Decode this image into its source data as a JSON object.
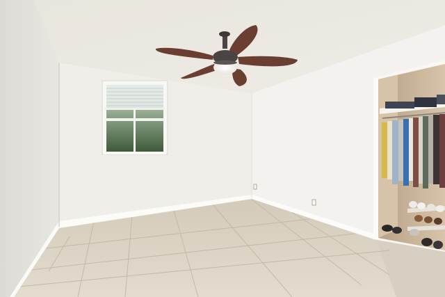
{
  "scene": {
    "kind": "empty bedroom interior photo",
    "colors": {
      "ceiling": "#ebe8e1",
      "wall_back": "#f1efea",
      "wall_left": "#e3e1dc",
      "wall_right": "#f4f2ee",
      "floor": "#d8cfbf",
      "grout": "#c2b8a6",
      "baseboard": "#fbfbf8",
      "closet_interior": "#c9b49a",
      "fan_blade": "#6a3f31",
      "fan_motor": "#4a4442",
      "window_glass": "#4f6b4a"
    },
    "objects": [
      "ceiling-fan",
      "window-with-blinds",
      "open-closet",
      "hanging-clothes",
      "shoe-rack",
      "electrical-outlet",
      "tile-floor"
    ]
  }
}
